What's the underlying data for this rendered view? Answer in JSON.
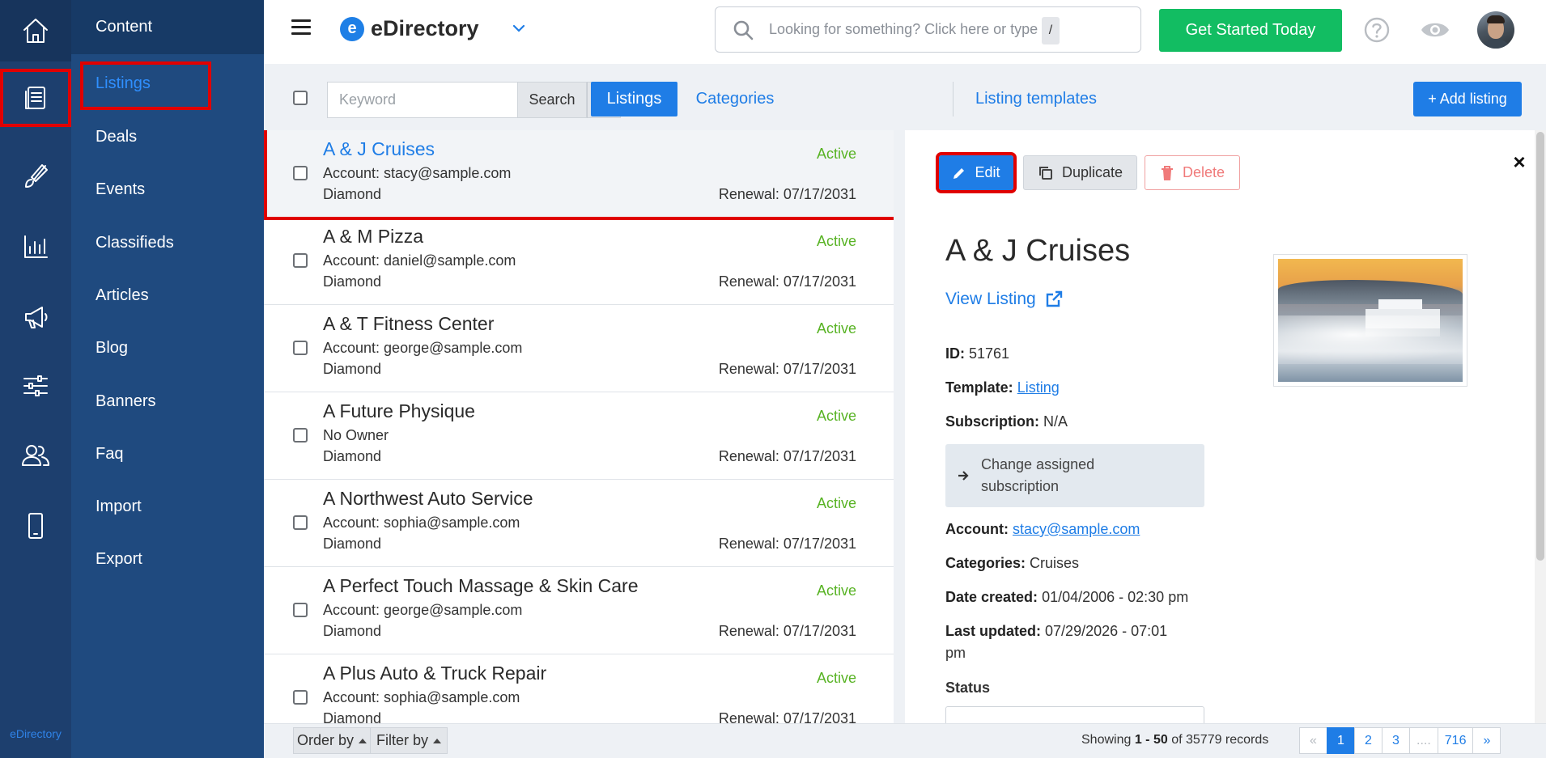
{
  "rail": {
    "brand": "eDirectory",
    "items": [
      {
        "icon": "home-icon"
      },
      {
        "icon": "content-icon"
      },
      {
        "icon": "brush-icon"
      },
      {
        "icon": "reports-icon"
      },
      {
        "icon": "megaphone-icon"
      },
      {
        "icon": "settings-sliders-icon"
      },
      {
        "icon": "users-icon"
      },
      {
        "icon": "mobile-icon"
      }
    ]
  },
  "sidebar": {
    "header": "Content",
    "items": [
      {
        "label": "Listings"
      },
      {
        "label": "Deals"
      },
      {
        "label": "Events"
      },
      {
        "label": "Classifieds"
      },
      {
        "label": "Articles"
      },
      {
        "label": "Blog"
      },
      {
        "label": "Banners"
      },
      {
        "label": "Faq"
      },
      {
        "label": "Import"
      },
      {
        "label": "Export"
      }
    ]
  },
  "topbar": {
    "logo_text": "eDirectory",
    "logo_mark": "e",
    "search_placeholder": "Looking for something? Click here or type",
    "search_shortcut": "/",
    "cta_label": "Get Started Today"
  },
  "toolbar": {
    "keyword_placeholder": "Keyword",
    "search_label": "Search",
    "tabs": [
      {
        "label": "Listings"
      },
      {
        "label": "Categories"
      },
      {
        "label": "Listing templates"
      }
    ],
    "add_label": "+ Add listing"
  },
  "listings": [
    {
      "title": "A & J Cruises",
      "status": "Active",
      "account": "Account: stacy@sample.com",
      "level": "Diamond",
      "renewal": "Renewal: 07/17/2031"
    },
    {
      "title": "A & M Pizza",
      "status": "Active",
      "account": "Account: daniel@sample.com",
      "level": "Diamond",
      "renewal": "Renewal: 07/17/2031"
    },
    {
      "title": "A & T Fitness Center",
      "status": "Active",
      "account": "Account: george@sample.com",
      "level": "Diamond",
      "renewal": "Renewal: 07/17/2031"
    },
    {
      "title": "A Future Physique",
      "status": "Active",
      "account": "No Owner",
      "level": "Diamond",
      "renewal": "Renewal: 07/17/2031"
    },
    {
      "title": "A Northwest Auto Service",
      "status": "Active",
      "account": "Account: sophia@sample.com",
      "level": "Diamond",
      "renewal": "Renewal: 07/17/2031"
    },
    {
      "title": "A Perfect Touch Massage & Skin Care",
      "status": "Active",
      "account": "Account: george@sample.com",
      "level": "Diamond",
      "renewal": "Renewal: 07/17/2031"
    },
    {
      "title": "A Plus Auto & Truck Repair",
      "status": "Active",
      "account": "Account: sophia@sample.com",
      "level": "Diamond",
      "renewal": "Renewal: 07/17/2031"
    }
  ],
  "detail": {
    "edit_label": "Edit",
    "duplicate_label": "Duplicate",
    "delete_label": "Delete",
    "close_label": "×",
    "title": "A & J Cruises",
    "view_listing": "View Listing",
    "id_label": "ID:",
    "id_value": "51761",
    "template_label": "Template:",
    "template_value": "Listing",
    "subscription_label": "Subscription:",
    "subscription_value": "N/A",
    "change_subscription_line1": "Change assigned",
    "change_subscription_line2": "subscription",
    "account_label": "Account:",
    "account_value": "stacy@sample.com",
    "categories_label": "Categories:",
    "categories_value": "Cruises",
    "created_label": "Date created:",
    "created_value": "01/04/2006 - 02:30 pm",
    "updated_label": "Last updated:",
    "updated_value_line1": "07/29/2026 - 07:01",
    "updated_value_line2": "pm",
    "status_label": "Status"
  },
  "footer": {
    "order_by": "Order by",
    "filter_by": "Filter by",
    "showing_prefix": "Showing",
    "showing_range": "1 - 50",
    "showing_suffix": "of 35779 records",
    "pages": [
      "«",
      "1",
      "2",
      "3",
      "....",
      "716",
      "»"
    ]
  },
  "colors": {
    "rail_bg": "#1d3f6e",
    "sidebar_bg": "#1f4a7f",
    "accent": "#1f7de6",
    "cta": "#12bd62",
    "active_status": "#58b324",
    "highlight": "#e00000"
  }
}
